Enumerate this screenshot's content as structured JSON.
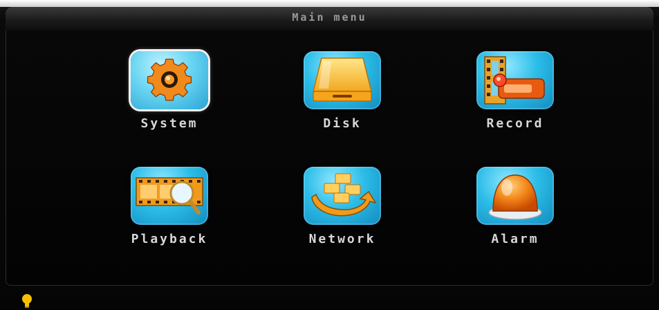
{
  "window": {
    "title": "Main menu"
  },
  "menu": {
    "items": [
      {
        "label": "System",
        "icon": "gear-icon",
        "selected": true
      },
      {
        "label": "Disk",
        "icon": "disk-icon",
        "selected": false
      },
      {
        "label": "Record",
        "icon": "record-icon",
        "selected": false
      },
      {
        "label": "Playback",
        "icon": "playback-icon",
        "selected": false
      },
      {
        "label": "Network",
        "icon": "network-icon",
        "selected": false
      },
      {
        "label": "Alarm",
        "icon": "alarm-icon",
        "selected": false
      }
    ]
  },
  "colors": {
    "tile": "#2cbde8",
    "icon_orange": "#f08a1c",
    "label": "#d8d8d8",
    "title": "#9a9a9a",
    "hint": "#f5c000"
  },
  "footer": {
    "hint_icon": "lightbulb-icon"
  }
}
